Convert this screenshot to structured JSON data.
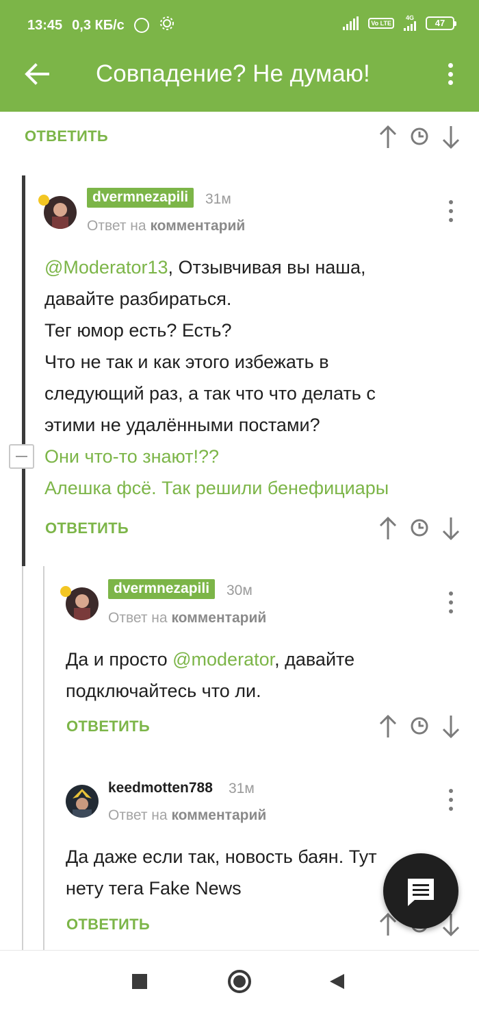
{
  "status_bar": {
    "time": "13:45",
    "speed": "0,3 КБ/с",
    "network_label_small": "4G",
    "lte_label": "Vo LTE",
    "battery": "47"
  },
  "app_bar": {
    "title": "Совпадение? Не думаю!"
  },
  "top_actions": {
    "reply_label": "ОТВЕТИТЬ"
  },
  "comments": [
    {
      "username": "dvermnezapili",
      "time": "31м",
      "reply_to_prefix": "Ответ на",
      "reply_to_target": "комментарий",
      "mention": "@Moderator13",
      "lines_after_mention": ",  Отзывчивая вы наша,",
      "lines": [
        "давайте разбираться.",
        "Тег юмор есть? Есть?",
        "Что не так и как этого избежать в",
        "следующий раз, а так что что делать с",
        "этими не удалёнными постами?"
      ],
      "links": [
        "Они что-то знают!??",
        "Алешка фсё. Так решили бенефициары"
      ],
      "reply_label": "ОТВЕТИТЬ"
    },
    {
      "username": "dvermnezapili",
      "time": "30м",
      "reply_to_prefix": "Ответ на",
      "reply_to_target": "комментарий",
      "text_before": "Да и просто ",
      "mention": "@moderator",
      "text_after": ",  давайте",
      "line2": "подключайтесь что ли.",
      "reply_label": "ОТВЕТИТЬ"
    },
    {
      "username": "keedmotten788",
      "time": "31м",
      "reply_to_prefix": "Ответ на",
      "reply_to_target": "комментарий",
      "line1": "Да даже если так, новость баян. Тут",
      "line2": "нету тега Fake News",
      "reply_label": "ОТВЕТИТЬ"
    }
  ],
  "colors": {
    "accent": "#7cb548",
    "text": "#1f1f1f",
    "muted": "#9a9a9a",
    "fab": "#1f1f1f"
  }
}
